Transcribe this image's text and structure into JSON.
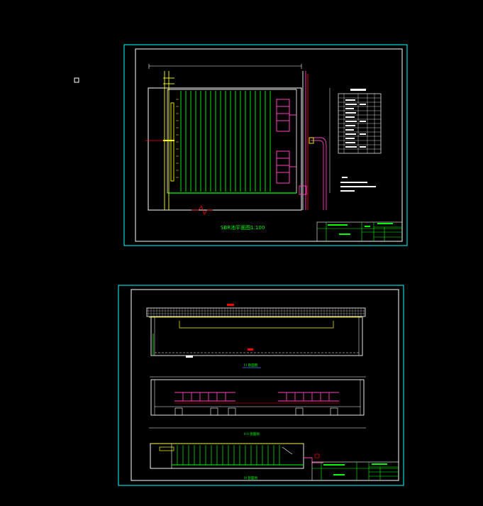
{
  "colors": {
    "background": "#000000",
    "sheet_frame": "#00ffff",
    "drawing_line": "#ffffff",
    "green": "#00ff00",
    "yellow": "#ffff00",
    "magenta": "#ff3fbf",
    "red": "#ff0000",
    "title_text": "#00ff00",
    "label_blue": "#4080ff"
  },
  "sheet1": {
    "plan_title": "SBR池平面图1:100"
  },
  "sheet2": {
    "section_title_1": "I-I 剖面图",
    "section_title_2": "II-II 剖面图",
    "section_title_3": "III 剖面图"
  },
  "icons": {
    "marker": "small-square-marker-icon"
  }
}
